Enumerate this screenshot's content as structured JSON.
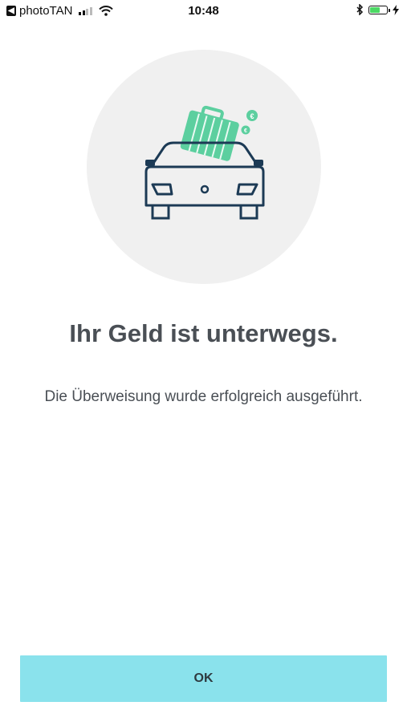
{
  "status_bar": {
    "back_glyph": "◀",
    "app_name": "photoTAN",
    "time": "10:48",
    "battery_level": 0.6,
    "icons": [
      "back-icon",
      "signal-icon",
      "wifi-icon",
      "bluetooth-icon",
      "battery-icon",
      "charging-icon"
    ]
  },
  "illustration": {
    "icon": "car-with-suitcase-icon",
    "coin_symbol": "€"
  },
  "content": {
    "headline": "Ihr Geld ist unterwegs.",
    "message": "Die Überweisung wurde erfolgreich ausgeführt."
  },
  "actions": {
    "ok_label": "OK"
  },
  "colors": {
    "accent": "#8ae2ec",
    "suitcase": "#5ccf9f",
    "car_outline": "#1c3a55",
    "text": "#4a4f55",
    "circle_bg": "#f0f0f0"
  }
}
